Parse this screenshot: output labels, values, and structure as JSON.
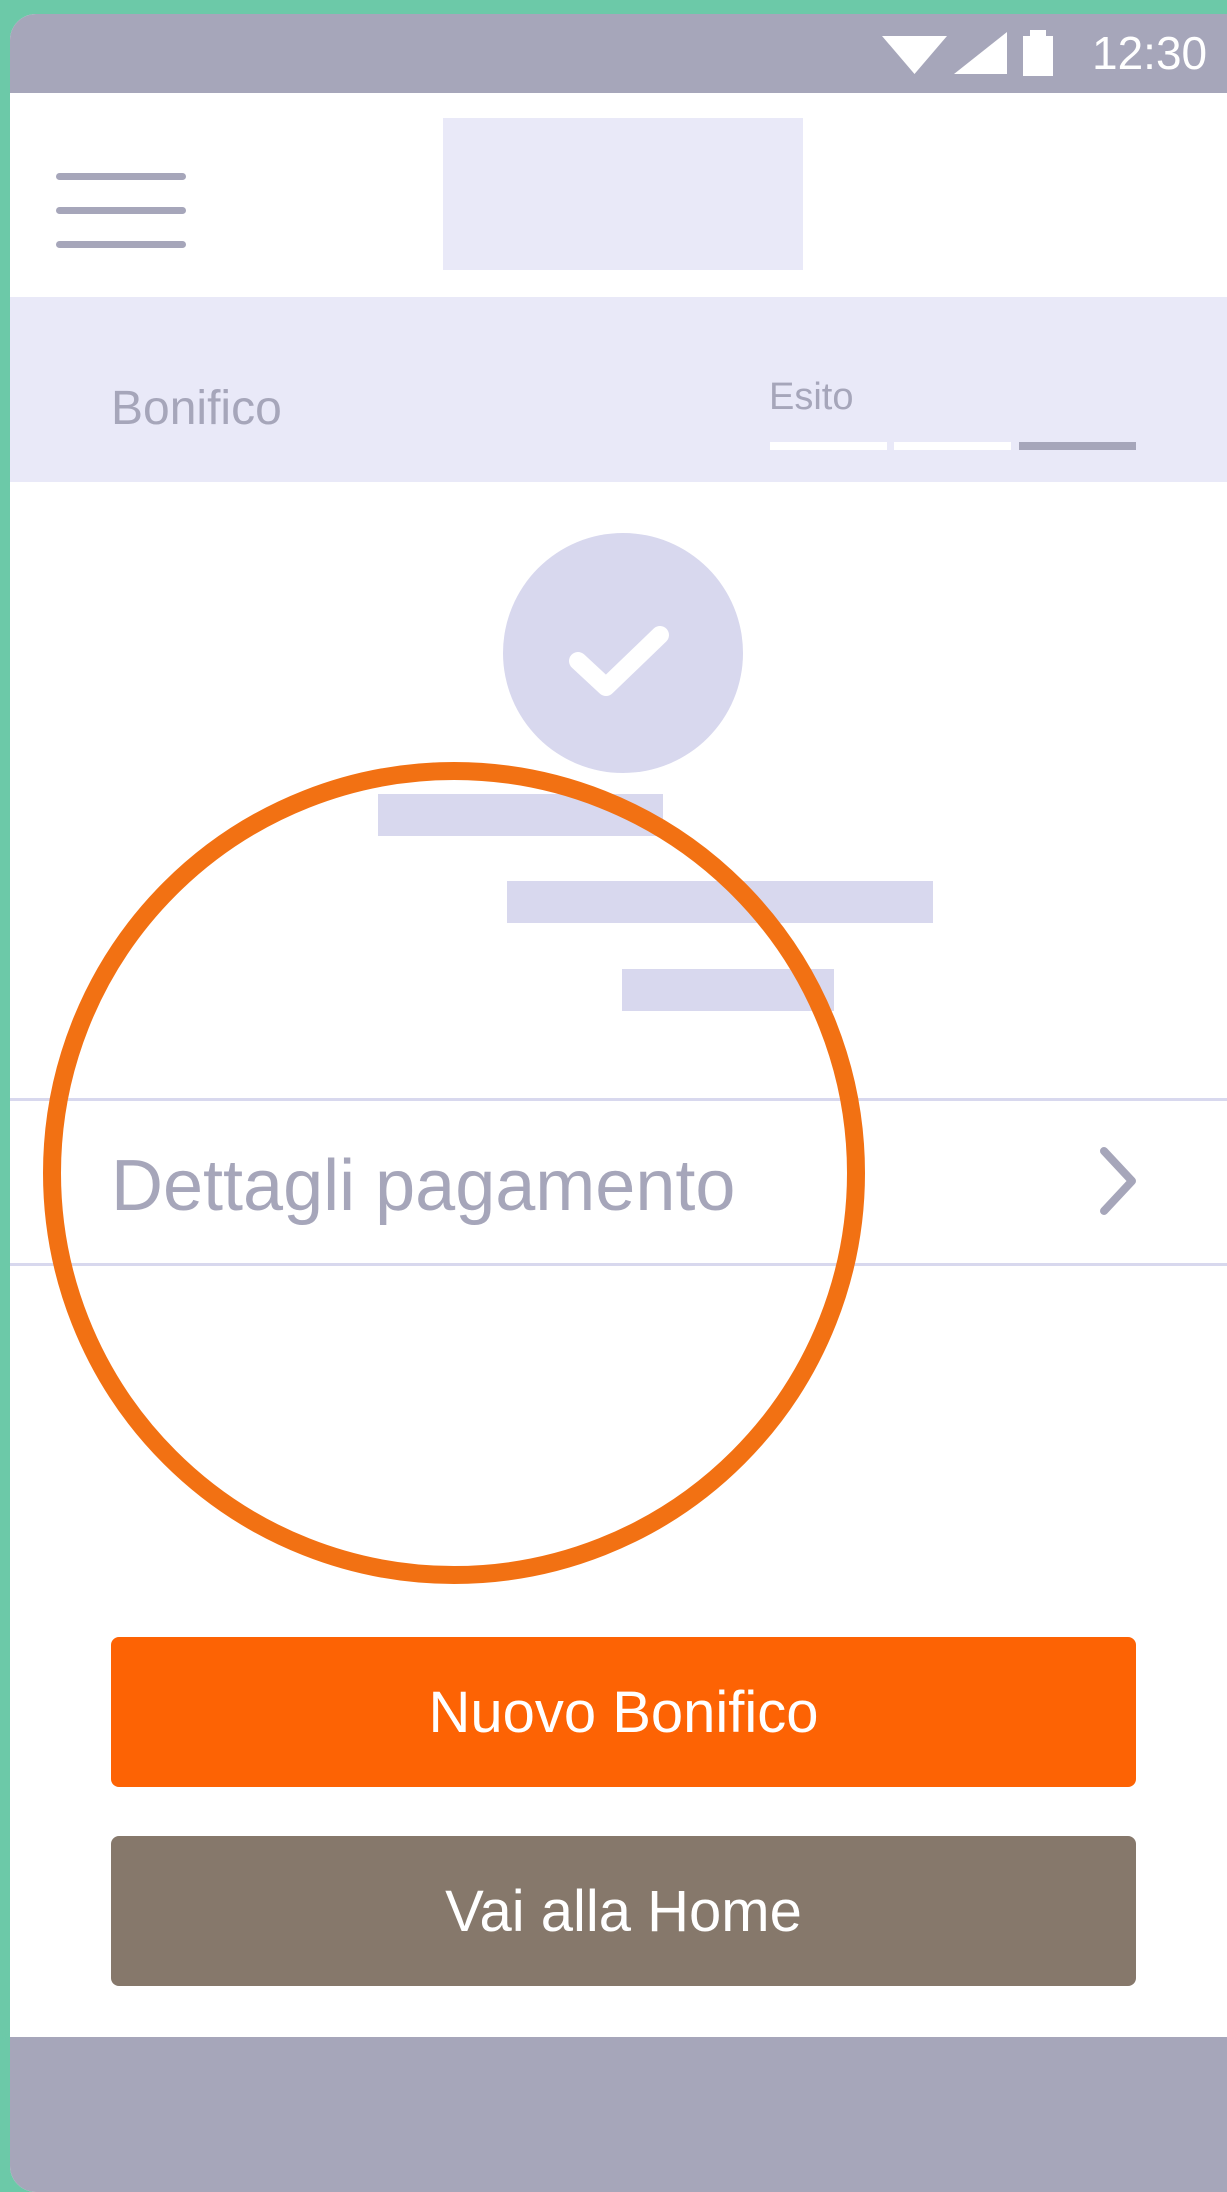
{
  "status_bar": {
    "time": "12:30",
    "icons": [
      "wifi-icon",
      "signal-icon",
      "battery-icon"
    ]
  },
  "header": {
    "menu_icon": "hamburger-menu-icon",
    "logo": "logo-placeholder"
  },
  "progress": {
    "title": "Bonifico",
    "step_label": "Esito",
    "steps_total": 3,
    "current_step": 3
  },
  "result": {
    "icon": "checkmark-icon"
  },
  "details": {
    "label": "Dettagli pagamento",
    "chevron_icon": "chevron-right-icon"
  },
  "actions": {
    "primary_label": "Nuovo Bonifico",
    "secondary_label": "Vai alla Home"
  },
  "colors": {
    "accent": "#fd6304",
    "secondary": "#86786b",
    "muted": "#a6a6ba",
    "light_bg": "#e9e9f8",
    "placeholder": "#d8d8ee",
    "highlight": "#f27113",
    "frame_bg": "#6cc9a8"
  }
}
